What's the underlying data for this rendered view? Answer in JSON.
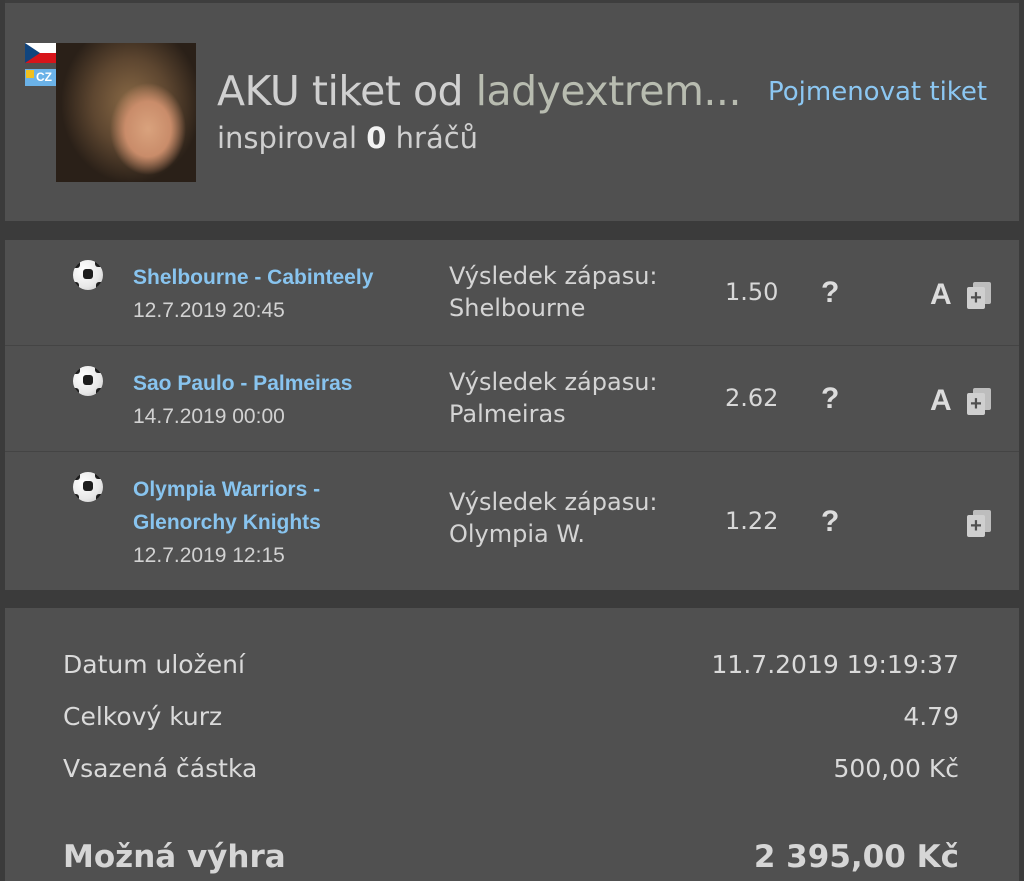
{
  "header": {
    "badge_text": "CZ",
    "title_prefix": "AKU tiket od",
    "title_user": "ladyextrem...",
    "inspired_prefix": "inspiroval",
    "inspired_count": "0",
    "inspired_suffix": "hráčů",
    "rename_label": "Pojmenovat tiket"
  },
  "matches": [
    {
      "name": "Shelbourne - Cabinteely",
      "date": "12.7.2019 20:45",
      "result_label": "Výsledek zápasu:",
      "result_value": "Shelbourne",
      "odds": "1.50",
      "help": "?",
      "tag": "A",
      "icon": "soccer-ball-icon"
    },
    {
      "name": "Sao Paulo - Palmeiras",
      "date": "14.7.2019 00:00",
      "result_label": "Výsledek zápasu:",
      "result_value": "Palmeiras",
      "odds": "2.62",
      "help": "?",
      "tag": "A",
      "icon": "soccer-ball-icon"
    },
    {
      "name_line1": "Olympia Warriors -",
      "name_line2": "Glenorchy Knights",
      "date": "12.7.2019 12:15",
      "result_label": "Výsledek zápasu:",
      "result_value": "Olympia W.",
      "odds": "1.22",
      "help": "?",
      "tag": "",
      "icon": "soccer-ball-icon"
    }
  ],
  "summary": {
    "saved_label": "Datum uložení",
    "saved_value": "11.7.2019 19:19:37",
    "total_odds_label": "Celkový kurz",
    "total_odds_value": "4.79",
    "stake_label": "Vsazená částka",
    "stake_value": "500,00 Kč",
    "win_label": "Možná výhra",
    "win_value": "2 395,00 Kč"
  },
  "colors": {
    "background": "#3b3b3b",
    "panel": "#505050",
    "link": "#88c4ef",
    "text": "#d9d9d9"
  }
}
